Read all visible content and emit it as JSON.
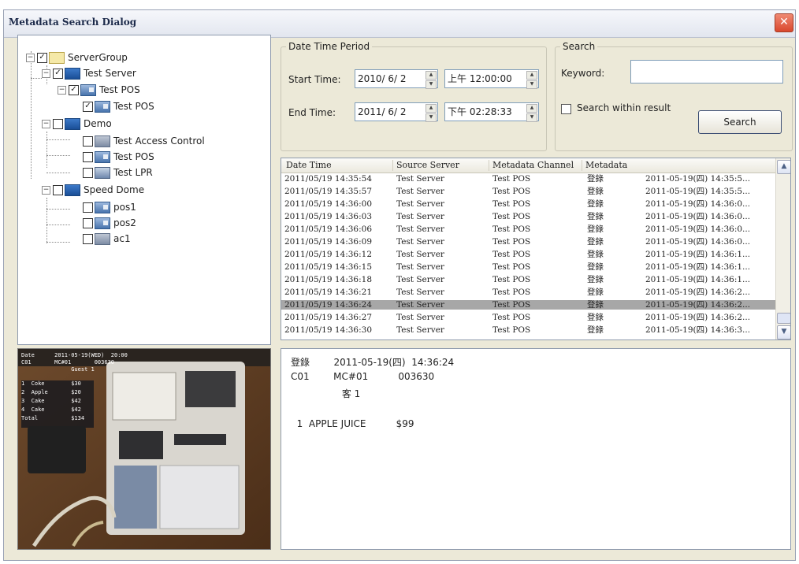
{
  "window": {
    "title": "Metadata Search Dialog",
    "close_glyph": "✕"
  },
  "tree": {
    "nodes": [
      {
        "label": "ServerGroup",
        "expander": "−",
        "checked": true,
        "icon": "folder-icon"
      },
      {
        "label": "Test Server",
        "expander": "−",
        "checked": true,
        "icon": "server-icon"
      },
      {
        "label": "Test POS",
        "expander": "−",
        "checked": true,
        "icon": "pos-icon"
      },
      {
        "label": "Test POS",
        "expander": "",
        "checked": true,
        "icon": "pos-channel-icon"
      },
      {
        "label": "Demo",
        "expander": "−",
        "checked": false,
        "icon": "server-icon"
      },
      {
        "label": "Test Access Control",
        "expander": "",
        "checked": false,
        "icon": "access-control-icon"
      },
      {
        "label": "Test POS",
        "expander": "",
        "checked": false,
        "icon": "pos-icon"
      },
      {
        "label": "Test LPR",
        "expander": "",
        "checked": false,
        "icon": "lpr-icon"
      },
      {
        "label": "Speed Dome",
        "expander": "−",
        "checked": false,
        "icon": "server-icon"
      },
      {
        "label": "pos1",
        "expander": "",
        "checked": false,
        "icon": "pos-icon"
      },
      {
        "label": "pos2",
        "expander": "",
        "checked": false,
        "icon": "pos-icon"
      },
      {
        "label": "ac1",
        "expander": "",
        "checked": false,
        "icon": "access-control-icon"
      }
    ]
  },
  "date_period": {
    "legend": "Date Time Period",
    "start_label": "Start Time:",
    "start_date": "2010/ 6/ 2",
    "start_time": "上午 12:00:00",
    "end_label": "End Time:",
    "end_date": "2011/ 6/ 2",
    "end_time": "下午 02:28:33"
  },
  "search": {
    "legend": "Search",
    "keyword_label": "Keyword:",
    "keyword_value": "",
    "within_label": "Search within result",
    "within_checked": false,
    "button_label": "Search"
  },
  "results": {
    "headers": [
      "Date Time",
      "Source Server",
      "Metadata Channel",
      "Metadata"
    ],
    "rows": [
      [
        "2011/05/19 14:35:54",
        "Test Server",
        "Test POS",
        "登錄",
        "2011-05-19(四)  14:35:5..."
      ],
      [
        "2011/05/19 14:35:57",
        "Test Server",
        "Test POS",
        "登錄",
        "2011-05-19(四)  14:35:5..."
      ],
      [
        "2011/05/19 14:36:00",
        "Test Server",
        "Test POS",
        "登錄",
        "2011-05-19(四)  14:36:0..."
      ],
      [
        "2011/05/19 14:36:03",
        "Test Server",
        "Test POS",
        "登錄",
        "2011-05-19(四)  14:36:0..."
      ],
      [
        "2011/05/19 14:36:06",
        "Test Server",
        "Test POS",
        "登錄",
        "2011-05-19(四)  14:36:0..."
      ],
      [
        "2011/05/19 14:36:09",
        "Test Server",
        "Test POS",
        "登錄",
        "2011-05-19(四)  14:36:0..."
      ],
      [
        "2011/05/19 14:36:12",
        "Test Server",
        "Test POS",
        "登錄",
        "2011-05-19(四)  14:36:1..."
      ],
      [
        "2011/05/19 14:36:15",
        "Test Server",
        "Test POS",
        "登錄",
        "2011-05-19(四)  14:36:1..."
      ],
      [
        "2011/05/19 14:36:18",
        "Test Server",
        "Test POS",
        "登錄",
        "2011-05-19(四)  14:36:1..."
      ],
      [
        "2011/05/19 14:36:21",
        "Test Server",
        "Test POS",
        "登錄",
        "2011-05-19(四)  14:36:2..."
      ],
      [
        "2011/05/19 14:36:24",
        "Test Server",
        "Test POS",
        "登錄",
        "2011-05-19(四)  14:36:2..."
      ],
      [
        "2011/05/19 14:36:27",
        "Test Server",
        "Test POS",
        "登錄",
        "2011-05-19(四)  14:36:2..."
      ],
      [
        "2011/05/19 14:36:30",
        "Test Server",
        "Test POS",
        "登錄",
        "2011-05-19(四)  14:36:3..."
      ]
    ],
    "selected_index": 10,
    "scroll_up": "▲",
    "scroll_down": "▼"
  },
  "detail": {
    "lines": [
      "登錄        2011-05-19(四)  14:36:24",
      "C01        MC#01          003630",
      "                 客 1",
      "",
      "  1  APPLE JUICE          $99"
    ]
  },
  "video": {
    "osd_lines": [
      "Date      2011-05-19(WED)  20:00",
      "C01       MC#01       003630",
      "               Guest 1",
      "1  Coke        $30",
      "2  Apple       $20",
      "3  Cake        $42",
      "4  Cake        $42",
      "Total          $134"
    ]
  },
  "colors": {
    "selection": "#a7a7a7",
    "window_bg": "#ece9d8",
    "close": "#d9472d"
  }
}
